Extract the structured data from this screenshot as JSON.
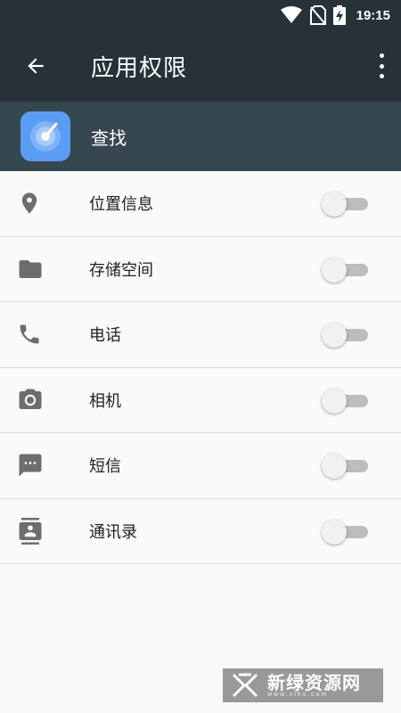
{
  "status_bar": {
    "time": "19:15",
    "icons": [
      "wifi-icon",
      "no-sim-icon",
      "battery-charging-icon"
    ]
  },
  "toolbar": {
    "title": "应用权限",
    "back_icon": "arrow-back-icon",
    "menu_icon": "more-vert-icon"
  },
  "app": {
    "name": "查找",
    "icon": "radar-icon",
    "icon_color": "#5a9cf2"
  },
  "colors": {
    "toolbar_bg": "#263238",
    "app_header_bg": "#37474f",
    "icon_gray": "#6d6d6d"
  },
  "permissions": [
    {
      "label": "位置信息",
      "icon": "location-pin-icon",
      "enabled": false
    },
    {
      "label": "存储空间",
      "icon": "folder-icon",
      "enabled": false
    },
    {
      "label": "电话",
      "icon": "phone-icon",
      "enabled": false
    },
    {
      "label": "相机",
      "icon": "camera-icon",
      "enabled": false
    },
    {
      "label": "短信",
      "icon": "sms-icon",
      "enabled": false
    },
    {
      "label": "通讯录",
      "icon": "contacts-icon",
      "enabled": false
    }
  ],
  "watermark": {
    "text": "新绿资源网",
    "url": "www.xlhs.com"
  }
}
